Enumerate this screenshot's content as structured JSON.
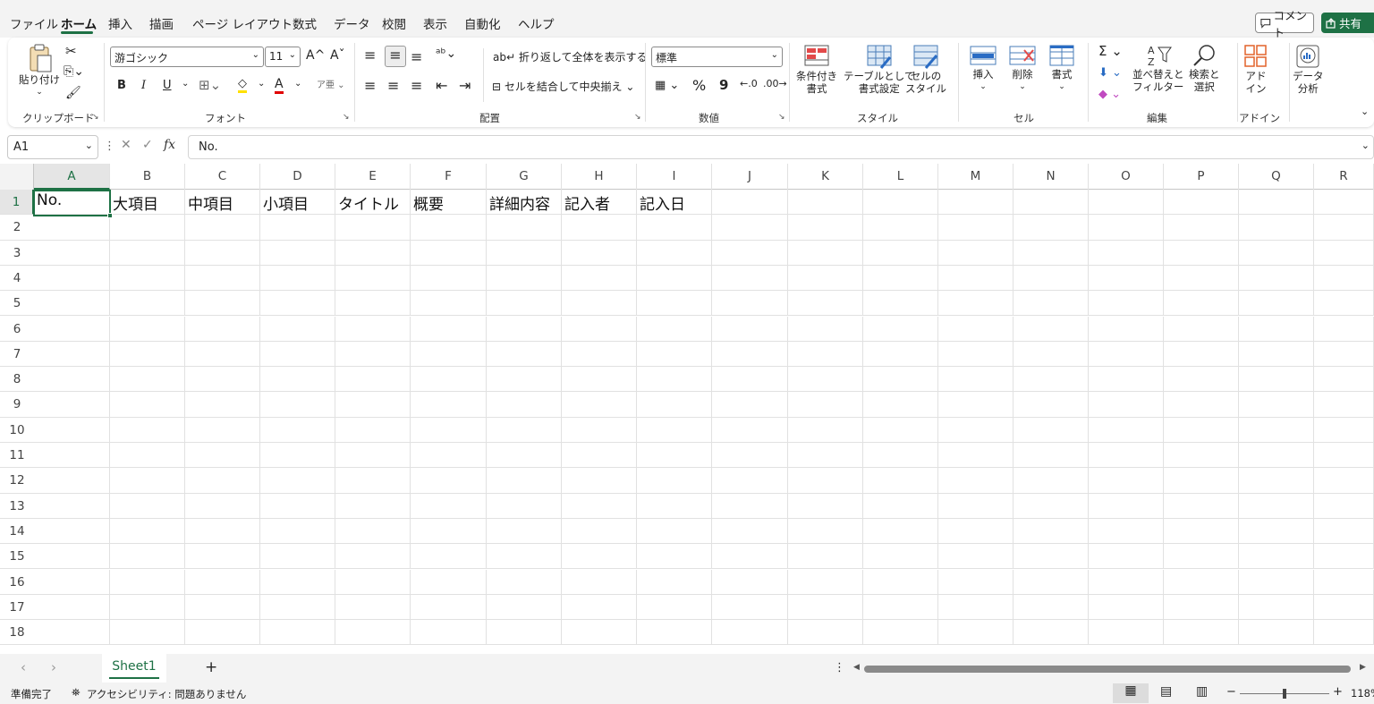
{
  "menu": {
    "items": [
      "ファイル",
      "ホーム",
      "挿入",
      "描画",
      "ページ レイアウト",
      "数式",
      "データ",
      "校閲",
      "表示",
      "自動化",
      "ヘルプ"
    ],
    "active": "ホーム",
    "comment_label": "コメント",
    "share_label": "共有"
  },
  "ribbon": {
    "clipboard": {
      "paste_label": "貼り付け",
      "group_label": "クリップボード"
    },
    "font": {
      "font_name": "游ゴシック",
      "font_size": "11",
      "group_label": "フォント",
      "bold": "B",
      "italic": "I",
      "underline": "U"
    },
    "alignment": {
      "wrap_label": "折り返して全体を表示する",
      "merge_label": "セルを結合して中央揃え",
      "group_label": "配置"
    },
    "number": {
      "format": "標準",
      "percent": "%",
      "comma": "9",
      "group_label": "数値"
    },
    "styles": {
      "conditional_label_1": "条件付き",
      "conditional_label_2": "書式",
      "table_label_1": "テーブルとして",
      "table_label_2": "書式設定",
      "cell_style_label_1": "セルの",
      "cell_style_label_2": "スタイル",
      "group_label": "スタイル"
    },
    "cells": {
      "insert_label": "挿入",
      "delete_label": "削除",
      "format_label": "書式",
      "group_label": "セル"
    },
    "editing": {
      "sort_label_1": "並べ替えと",
      "sort_label_2": "フィルター",
      "find_label_1": "検索と",
      "find_label_2": "選択",
      "group_label": "編集"
    },
    "addins": {
      "label_1": "アド",
      "label_2": "イン",
      "group_label": "アドイン"
    },
    "analysis": {
      "label_1": "データ",
      "label_2": "分析"
    }
  },
  "formula_bar": {
    "name_box": "A1",
    "fx": "fx",
    "content": "No."
  },
  "grid": {
    "columns": [
      "A",
      "B",
      "C",
      "D",
      "E",
      "F",
      "G",
      "H",
      "I",
      "J",
      "K",
      "L",
      "M",
      "N",
      "O",
      "P",
      "Q",
      "R"
    ],
    "rows": [
      "1",
      "2",
      "3",
      "4",
      "5",
      "6",
      "7",
      "8",
      "9",
      "10",
      "11",
      "12",
      "13",
      "14",
      "15",
      "16",
      "17",
      "18"
    ],
    "selected_cell": "A1",
    "row1": [
      "No.",
      "大項目",
      "中項目",
      "小項目",
      "タイトル",
      "概要",
      "詳細内容",
      "記入者",
      "記入日"
    ]
  },
  "sheets": {
    "tabs": [
      "Sheet1"
    ],
    "add_label": "+"
  },
  "status": {
    "ready": "準備完了",
    "accessibility": "アクセシビリティ: 問題ありません",
    "zoom": "118%"
  },
  "colors": {
    "accent": "#1e7145"
  }
}
